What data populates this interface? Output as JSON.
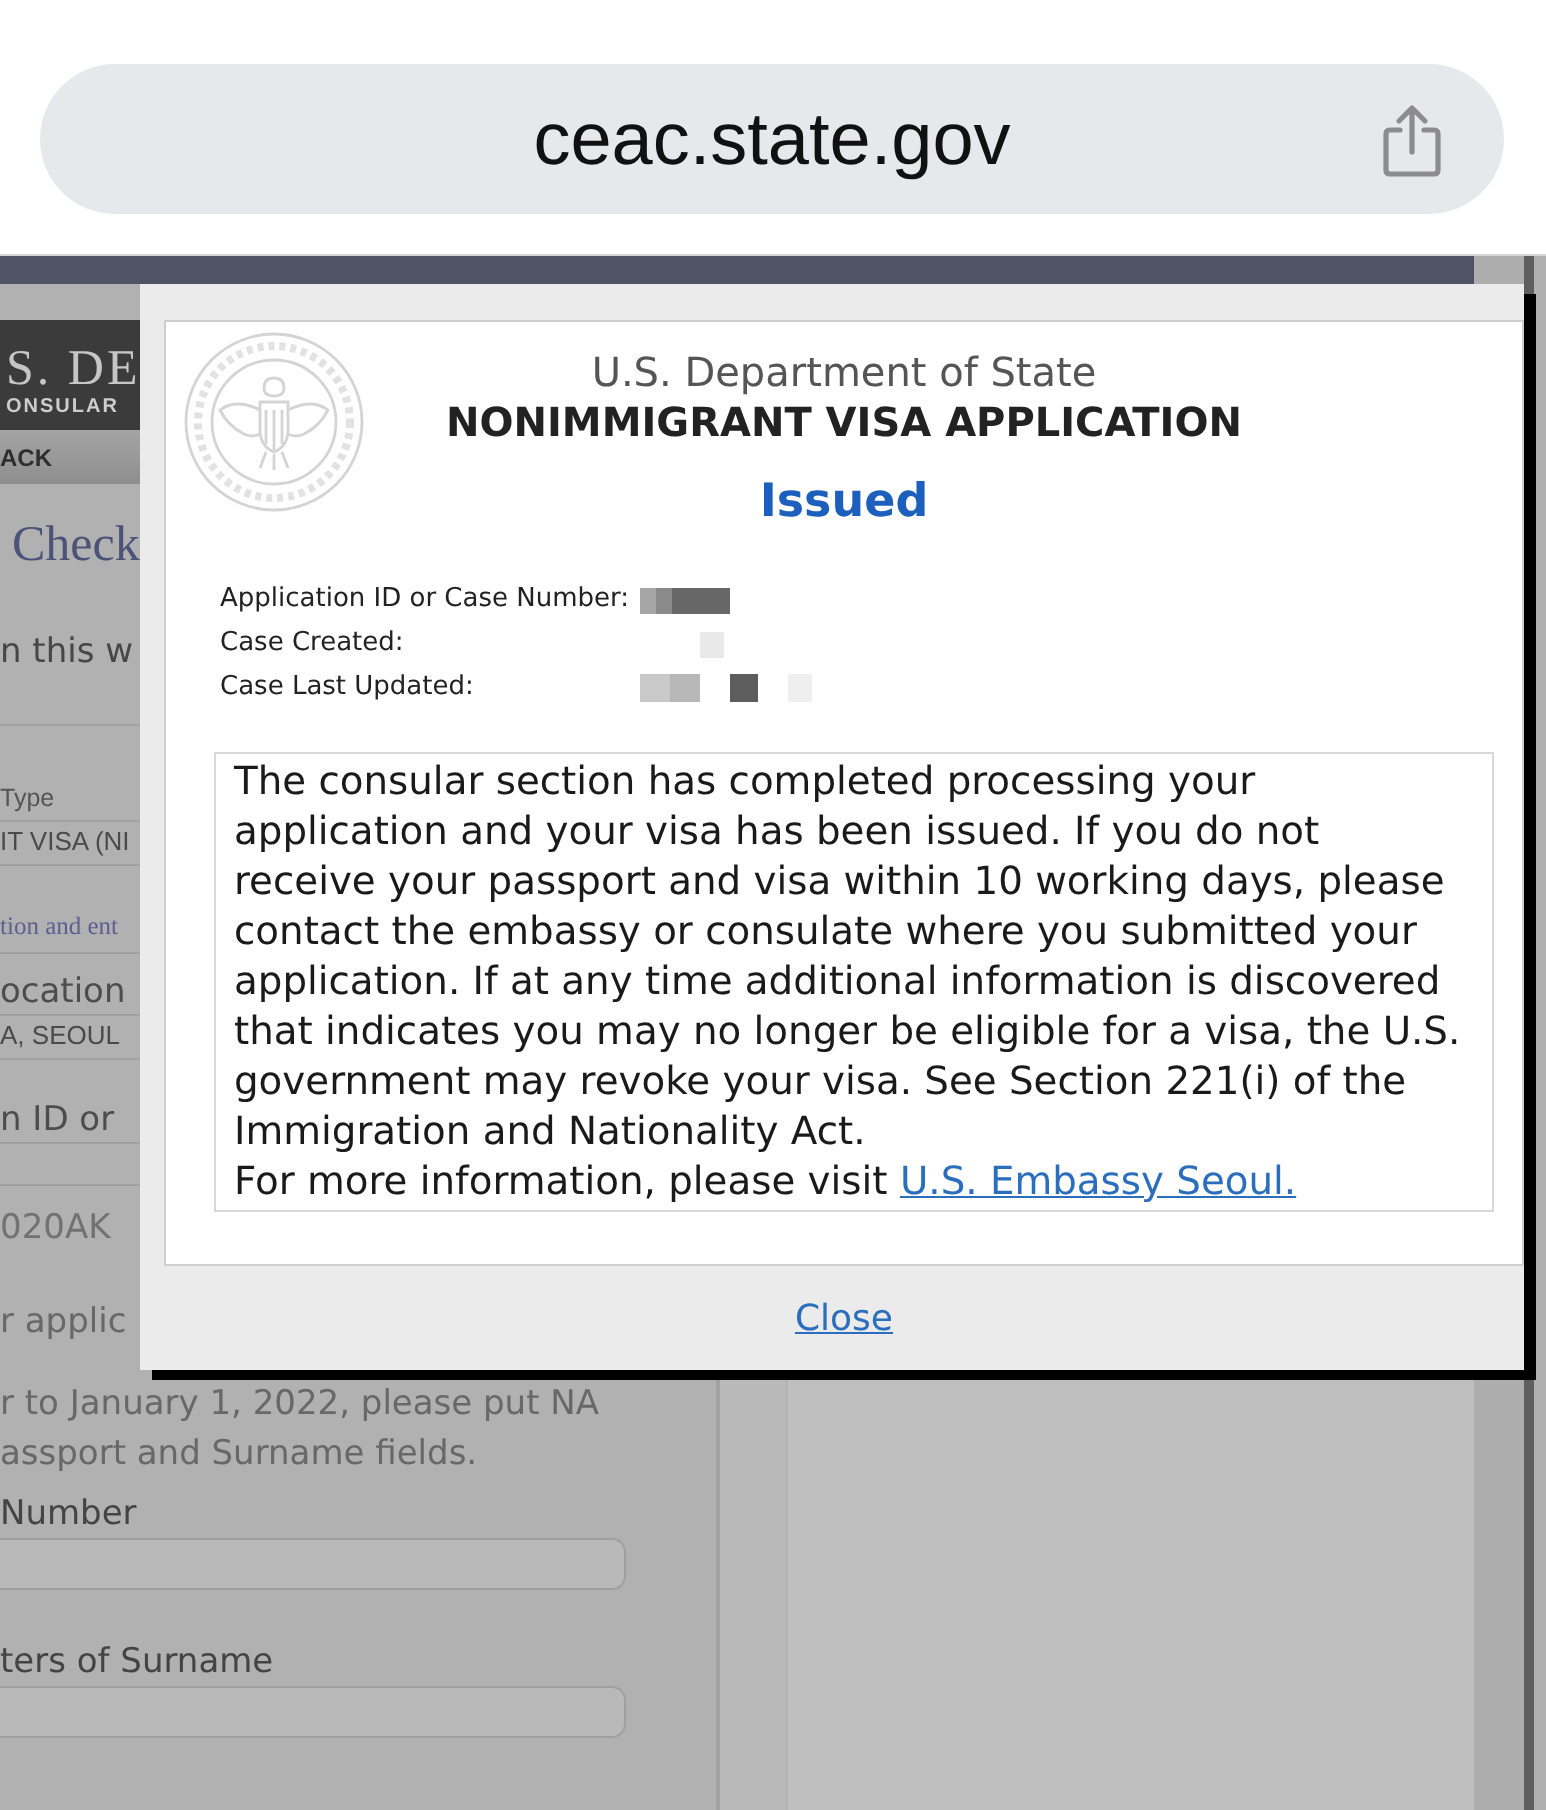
{
  "browser": {
    "url": "ceac.state.gov"
  },
  "background_page": {
    "banner_title": "S. DE",
    "banner_subtitle": "ONSULAR",
    "nav_link": "ACK",
    "heading": "Check",
    "intro": "n this w",
    "summary": [
      {
        "kind": "label",
        "text": "Type"
      },
      {
        "kind": "value",
        "text": "IT VISA (NI"
      },
      {
        "kind": "note",
        "text": "tion and ent"
      },
      {
        "kind": "heading",
        "text": "ocation"
      },
      {
        "kind": "value",
        "text": "A, SEOUL"
      },
      {
        "kind": "heading",
        "text": "n ID or"
      },
      {
        "kind": "entry",
        "text": "020AK"
      }
    ],
    "note_lines": [
      "r applic",
      "r to January 1, 2022, please put NA",
      "assport and Surname fields."
    ],
    "fields": [
      {
        "label": "Number"
      },
      {
        "label": "ters of Surname"
      }
    ]
  },
  "dialog": {
    "agency": "U.S. Department of State",
    "title": "NONIMMIGRANT VISA APPLICATION",
    "status": "Issued",
    "details": [
      {
        "label": "Application ID or Case Number:",
        "redacted": true
      },
      {
        "label": "Case Created:",
        "redacted": true
      },
      {
        "label": "Case Last Updated:",
        "redacted": true
      }
    ],
    "message": "The consular section has completed processing your application and your visa has been issued. If you do not receive your passport and visa within 10 working days, please contact the embassy or consulate where you submitted your application. If at any time additional information is discovered that indicates you may no longer be eligible for a visa, the U.S. government may revoke your visa. See Section 221(i) of the Immigration and Nationality Act.",
    "more_info": "For more information, please visit",
    "link": "U.S. Embassy Seoul.",
    "close": "Close"
  }
}
